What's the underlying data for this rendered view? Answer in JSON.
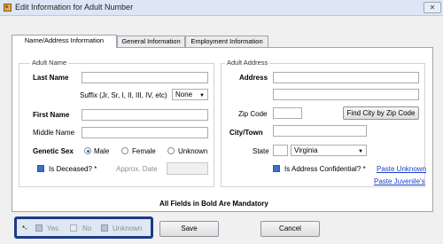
{
  "window": {
    "title": "Edit Information for Adult Number",
    "close_label": "✕"
  },
  "tabs": [
    {
      "label": "Name/Address Information"
    },
    {
      "label": "General Information"
    },
    {
      "label": "Employment Information"
    }
  ],
  "adult_name": {
    "group_title": "Adult Name",
    "last_name_label": "Last Name",
    "suffix_label": "Suffix (Jr, Sr, I, II, III, IV, etc)",
    "suffix_value": "None",
    "first_name_label": "First Name",
    "middle_name_label": "Middle Name",
    "genetic_sex_label": "Genetic Sex",
    "sex_options": [
      "Male",
      "Female",
      "Unknown"
    ],
    "sex_selected": "Male",
    "deceased_label": "Is Deceased? *",
    "approx_date_label": "Approx. Date"
  },
  "adult_address": {
    "group_title": "Adult Address",
    "address_label": "Address",
    "zip_label": "Zip Code",
    "find_city_button": "Find City by Zip Code",
    "city_label": "City/Town",
    "state_label": "State",
    "state_value": "Virginia",
    "confidential_label": "Is Address Confidential? *",
    "paste_unknown_link": "Paste Unknown",
    "paste_juvenile_link": "Paste Juvenile's"
  },
  "mandatory_note": "All Fields in Bold Are Mandatory",
  "footer": {
    "star_label": "*-",
    "yes_label": "Yes",
    "no_label": "No",
    "unknown_label": "Unknown",
    "save_button": "Save",
    "cancel_button": "Cancel"
  },
  "colors": {
    "highlight_border": "#1a3b8a",
    "link": "#1a3fc8",
    "check_fill": "#3b6fc9"
  }
}
